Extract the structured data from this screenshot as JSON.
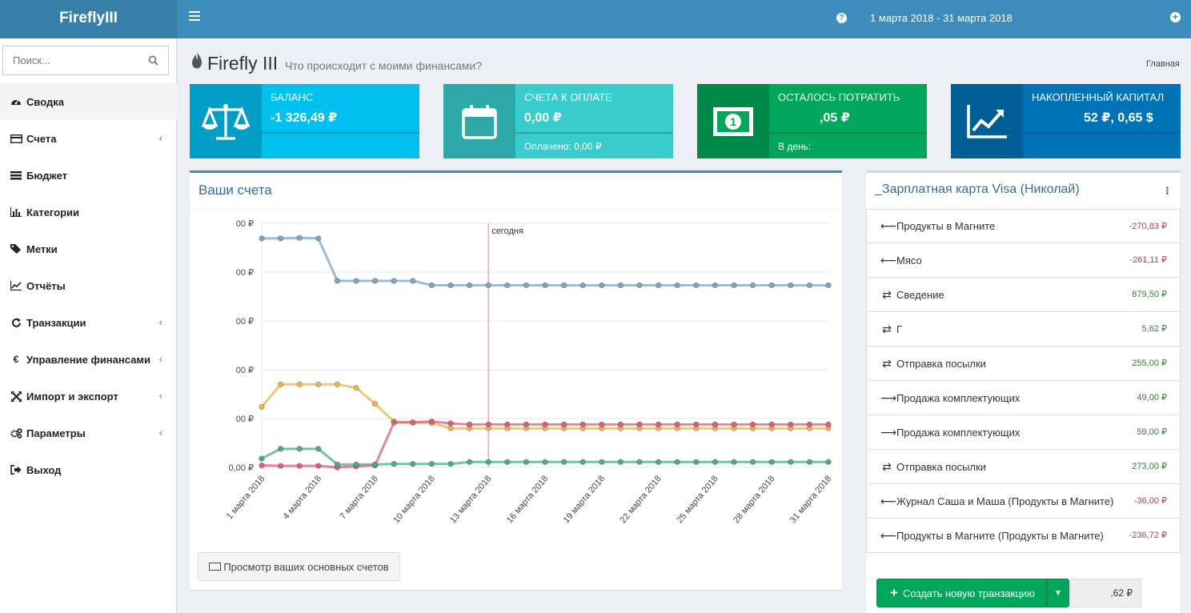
{
  "app": {
    "logo": "FireflyIII",
    "date_range": "1 марта 2018 - 31 марта 2018"
  },
  "sidebar": {
    "search_placeholder": "Поиск...",
    "items": [
      {
        "label": "Сводка",
        "icon": "dashboard-icon",
        "active": true
      },
      {
        "label": "Счета",
        "icon": "credit-card-icon",
        "has_children": true
      },
      {
        "label": "Бюджет",
        "icon": "tasks-icon"
      },
      {
        "label": "Категории",
        "icon": "bar-chart-icon"
      },
      {
        "label": "Метки",
        "icon": "tags-icon"
      },
      {
        "label": "Отчёты",
        "icon": "line-chart-icon"
      },
      {
        "label": "Транзакции",
        "icon": "repeat-icon",
        "has_children": true
      },
      {
        "label": "Управление финансами",
        "icon": "euro-icon",
        "has_children": true
      },
      {
        "label": "Импорт и экспорт",
        "icon": "arrows-icon",
        "has_children": true
      },
      {
        "label": "Параметры",
        "icon": "cogs-icon",
        "has_children": true
      },
      {
        "label": "Выход",
        "icon": "sign-out-icon"
      }
    ]
  },
  "header": {
    "title": "Firefly III",
    "subtitle": "Что происходит с моими финансами?",
    "breadcrumb": "Главная"
  },
  "info_boxes": [
    {
      "label": "БАЛАНС",
      "value": "-1 326,49 ₽",
      "sub": "",
      "color": "#00c0ef",
      "icon": "balance-scale-icon"
    },
    {
      "label": "СЧЕТА К ОПЛАТЕ",
      "value": "0,00 ₽",
      "sub": "Оплачено: 0,00 ₽",
      "color": "#39cccc",
      "icon": "calendar-icon"
    },
    {
      "label": "ОСТАЛОСЬ ПОТРАТИТЬ",
      "value": ",05 ₽",
      "sub": "В день: ",
      "color": "#00a65a",
      "icon": "money-icon"
    },
    {
      "label": "НАКОПЛЕННЫЙ КАПИТАЛ",
      "value": "52 ₽, 0,65 $",
      "sub": "",
      "color": "#0073b7",
      "icon": "line-chart-icon"
    }
  ],
  "accounts_box": {
    "title": "Ваши счета",
    "view_button": "Просмотр ваших основных счетов"
  },
  "chart_data": {
    "type": "line",
    "today_label": "сегодня",
    "today_x": "13 марта 2018",
    "y_tick_labels": [
      "00 ₽",
      "00 ₽",
      "00 ₽",
      "00 ₽",
      "00 ₽",
      "0,00 ₽"
    ],
    "x_tick_labels": [
      "1 марта 2018",
      "4 марта 2018",
      "7 марта 2018",
      "10 марта 2018",
      "13 марта 2018",
      "16 марта 2018",
      "19 марта 2018",
      "22 марта 2018",
      "25 марта 2018",
      "28 марта 2018",
      "31 марта 2018"
    ],
    "ylim": [
      0,
      5
    ],
    "series": [
      {
        "color": "#7ea6c3",
        "values": [
          4.69,
          4.69,
          4.7,
          4.69,
          3.82,
          3.82,
          3.82,
          3.82,
          3.82,
          3.73,
          3.73,
          3.73,
          3.73,
          3.73,
          3.73,
          3.73,
          3.73,
          3.73,
          3.73,
          3.73,
          3.73,
          3.73,
          3.73,
          3.73,
          3.73,
          3.73,
          3.73,
          3.73,
          3.73,
          3.73,
          3.73
        ]
      },
      {
        "color": "#e8b454",
        "values": [
          1.24,
          1.7,
          1.7,
          1.7,
          1.7,
          1.63,
          1.3,
          0.94,
          0.92,
          0.91,
          0.8,
          0.8,
          0.8,
          0.8,
          0.8,
          0.8,
          0.8,
          0.8,
          0.8,
          0.8,
          0.8,
          0.8,
          0.8,
          0.8,
          0.8,
          0.8,
          0.8,
          0.8,
          0.8,
          0.8,
          0.8
        ]
      },
      {
        "color": "#d95f7f",
        "values": [
          0.04,
          0.03,
          0.03,
          0.03,
          0.0,
          0.02,
          0.04,
          0.92,
          0.92,
          0.94,
          0.9,
          0.88,
          0.88,
          0.88,
          0.88,
          0.88,
          0.88,
          0.88,
          0.88,
          0.88,
          0.88,
          0.88,
          0.88,
          0.88,
          0.88,
          0.88,
          0.88,
          0.88,
          0.88,
          0.88,
          0.88
        ]
      },
      {
        "color": "#4cae7c",
        "values": [
          0.18,
          0.38,
          0.38,
          0.38,
          0.06,
          0.06,
          0.06,
          0.07,
          0.07,
          0.07,
          0.07,
          0.11,
          0.11,
          0.11,
          0.11,
          0.11,
          0.11,
          0.11,
          0.11,
          0.11,
          0.11,
          0.11,
          0.11,
          0.11,
          0.11,
          0.11,
          0.11,
          0.11,
          0.11,
          0.11,
          0.11
        ]
      }
    ]
  },
  "account_panel": {
    "title": "_Зарплатная карта Visa (Николай)",
    "transactions": [
      {
        "arrow": "⟵",
        "kind": "withdrawal",
        "desc": "Продукты в Магните",
        "amount": "-270,83 ₽",
        "sign": "neg"
      },
      {
        "arrow": "⟵",
        "kind": "withdrawal",
        "desc": "Мясо",
        "amount": "-261,11 ₽",
        "sign": "neg"
      },
      {
        "arrow": "⇄",
        "kind": "transfer",
        "desc": "Сведение",
        "amount": "879,50 ₽",
        "sign": "pos"
      },
      {
        "arrow": "⇄",
        "kind": "transfer",
        "desc": "Г",
        "amount": "5,62 ₽",
        "sign": "pos"
      },
      {
        "arrow": "⇄",
        "kind": "transfer",
        "desc": "Отправка посылки",
        "amount": "255,00 ₽",
        "sign": "pos"
      },
      {
        "arrow": "⟶",
        "kind": "deposit",
        "desc": "Продажа комплектующих",
        "amount": "49,00 ₽",
        "sign": "pos"
      },
      {
        "arrow": "⟶",
        "kind": "deposit",
        "desc": "Продажа комплектующих",
        "amount": "59,00 ₽",
        "sign": "pos"
      },
      {
        "arrow": "⇄",
        "kind": "transfer",
        "desc": "Отправка посылки",
        "amount": "273,00 ₽",
        "sign": "pos"
      },
      {
        "arrow": "⟵",
        "kind": "withdrawal",
        "desc": "Журнал Саша и Маша (Продукты в Магните)",
        "amount": "-36,00 ₽",
        "sign": "neg"
      },
      {
        "arrow": "⟵",
        "kind": "withdrawal",
        "desc": "Продукты в Магните (Продукты в Магните)",
        "amount": "-236,72 ₽",
        "sign": "neg"
      }
    ],
    "create_button": "Создать новую транзакцию",
    "balance": ",62 ₽"
  }
}
